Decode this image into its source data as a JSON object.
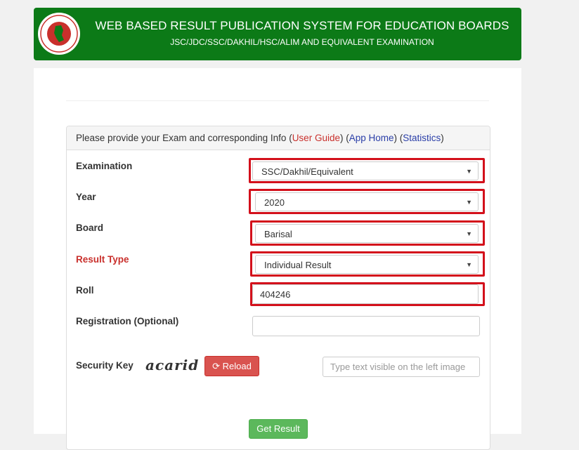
{
  "header": {
    "title": "WEB BASED RESULT PUBLICATION SYSTEM FOR EDUCATION BOARDS",
    "subtitle": "JSC/JDC/SSC/DAKHIL/HSC/ALIM AND EQUIVALENT EXAMINATION"
  },
  "panel": {
    "intro": "Please provide your Exam and corresponding Info",
    "user_guide": "User Guide",
    "app_home": "App Home",
    "statistics": "Statistics"
  },
  "form": {
    "examination": {
      "label": "Examination",
      "value": "SSC/Dakhil/Equivalent"
    },
    "year": {
      "label": "Year",
      "value": "2020"
    },
    "board": {
      "label": "Board",
      "value": "Barisal"
    },
    "result_type": {
      "label": "Result Type",
      "value": "Individual Result"
    },
    "roll": {
      "label": "Roll",
      "value": "404246"
    },
    "registration": {
      "label": "Registration (Optional)",
      "value": ""
    },
    "security": {
      "label": "Security Key",
      "captcha": "acarid",
      "reload": "Reload",
      "placeholder": "Type text visible on the left image"
    },
    "submit": "Get Result"
  },
  "colors": {
    "header_green": "#0c7a17",
    "highlight_red": "#d3101b",
    "reload_red": "#d9534f",
    "submit_green": "#5cb85c"
  }
}
